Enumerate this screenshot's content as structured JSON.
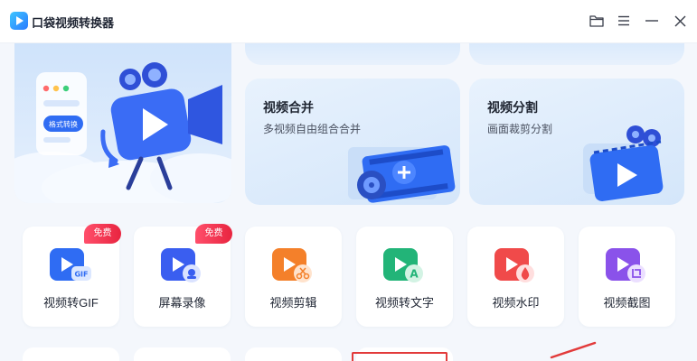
{
  "app": {
    "title": "口袋视频转换器"
  },
  "window_controls": [
    "folder-icon",
    "menu-icon",
    "minimize-icon",
    "close-icon"
  ],
  "banner": {
    "pill_text": "格式转换"
  },
  "features": [
    {
      "title": "视频合并",
      "subtitle": "多视频自由组合合并"
    },
    {
      "title": "视频分割",
      "subtitle": "画面裁剪分割"
    }
  ],
  "tools": [
    {
      "label": "视频转GIF",
      "badge": "免费",
      "icon": "video-gif-icon",
      "color": "#2f6cf3"
    },
    {
      "label": "屏幕录像",
      "badge": "免费",
      "icon": "screen-record-icon",
      "color": "#3a5ef0"
    },
    {
      "label": "视频剪辑",
      "badge": "",
      "icon": "video-cut-icon",
      "color": "#f4802a"
    },
    {
      "label": "视频转文字",
      "badge": "",
      "icon": "video-text-icon",
      "color": "#22b478"
    },
    {
      "label": "视频水印",
      "badge": "",
      "icon": "video-watermark-icon",
      "color": "#f04a4a"
    },
    {
      "label": "视频截图",
      "badge": "",
      "icon": "video-screenshot-icon",
      "color": "#8a52ea"
    }
  ],
  "colors": {
    "accent": "#2f6cf3",
    "badge": "#e8243f",
    "highlight": "#e23b3b"
  }
}
